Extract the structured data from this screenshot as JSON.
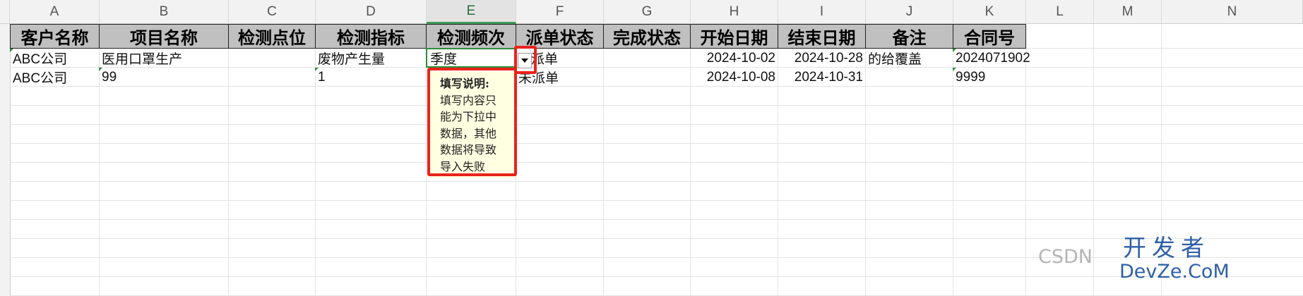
{
  "columns": [
    "A",
    "B",
    "C",
    "D",
    "E",
    "F",
    "G",
    "H",
    "I",
    "J",
    "K",
    "L",
    "M",
    "N"
  ],
  "header_row": [
    "客户名称",
    "项目名称",
    "检测点位",
    "检测指标",
    "检测频次",
    "派单状态",
    "完成状态",
    "开始日期",
    "结束日期",
    "备注",
    "合同号"
  ],
  "rows": [
    [
      "ABC公司",
      "医用口罩生产",
      "",
      "废物产生量",
      "季度",
      "派单",
      "",
      "2024-10-02",
      "2024-10-28",
      "的给覆盖",
      "2024071902"
    ],
    [
      "ABC公司",
      "99",
      "",
      "1",
      "",
      "未派单",
      "",
      "2024-10-08",
      "2024-10-31",
      "",
      "9999"
    ]
  ],
  "tooltip": {
    "title": "填写说明:",
    "lines": [
      "填写内容只",
      "能为下拉中",
      "数据，其他",
      "数据将导致",
      "导入失败"
    ]
  },
  "dropdown_icon": "chevron-down-icon",
  "watermark": {
    "csdn": "CSDN",
    "top": "开发者",
    "bottom": "DevZe.CoM"
  },
  "colors": {
    "accent": "#2e8b3a",
    "highlight": "#e8231c",
    "header_fill": "#c0c0c0",
    "tooltip_bg": "#ffffe1"
  }
}
